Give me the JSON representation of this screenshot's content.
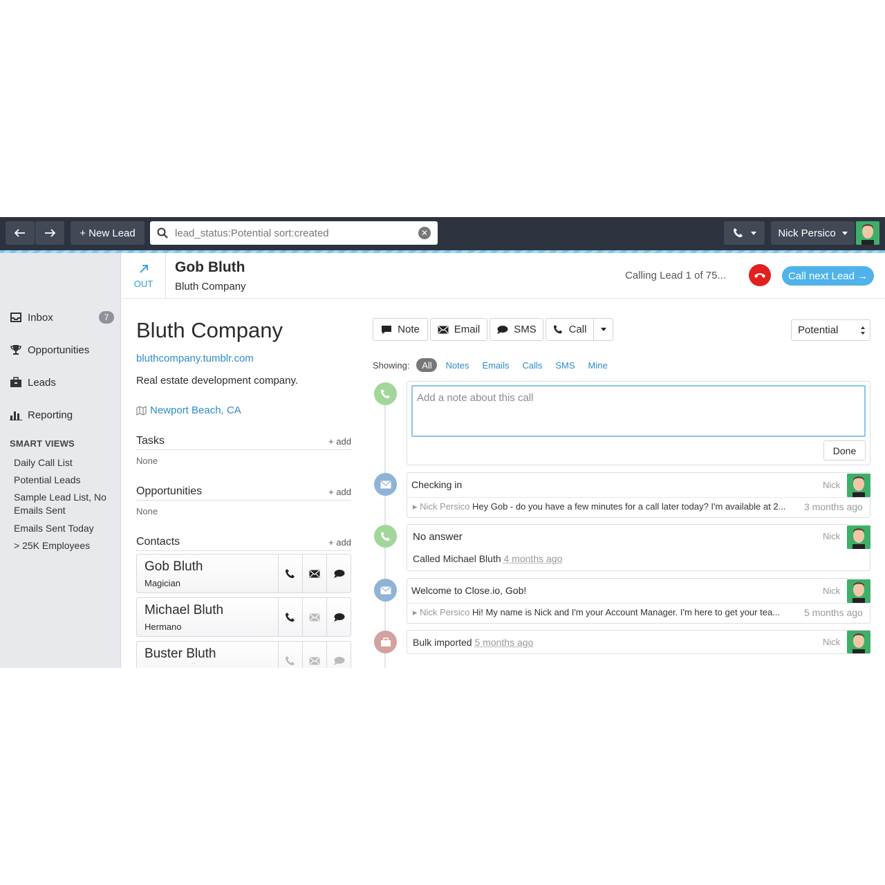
{
  "topbar": {
    "new_lead_label": "+ New Lead",
    "search_value": "lead_status:Potential sort:created",
    "user_name": "Nick Persico"
  },
  "sidebar": {
    "items": [
      {
        "label": "Inbox",
        "icon": "inbox-icon",
        "badge": "7"
      },
      {
        "label": "Opportunities",
        "icon": "trophy-icon"
      },
      {
        "label": "Leads",
        "icon": "briefcase-icon"
      },
      {
        "label": "Reporting",
        "icon": "bar-chart-icon"
      }
    ],
    "smart_views_heading": "SMART VIEWS",
    "smart_views": [
      "Daily Call List",
      "Potential Leads",
      "Sample Lead List, No Emails Sent",
      "Emails Sent Today",
      "> 25K Employees"
    ]
  },
  "lead_header": {
    "direction": "OUT",
    "name": "Gob Bluth",
    "company": "Bluth Company",
    "calling_status": "Calling Lead 1 of 75...",
    "call_next_label": "Call next Lead →"
  },
  "company": {
    "title": "Bluth Company",
    "url": "bluthcompany.tumblr.com",
    "description": "Real estate development company.",
    "location": "Newport Beach, CA"
  },
  "sections": {
    "tasks": {
      "title": "Tasks",
      "add": "+ add",
      "empty": "None"
    },
    "opportunities": {
      "title": "Opportunities",
      "add": "+ add",
      "empty": "None"
    },
    "contacts": {
      "title": "Contacts",
      "add": "+ add"
    }
  },
  "contacts": [
    {
      "name": "Gob Bluth",
      "role": "Magician"
    },
    {
      "name": "Michael Bluth",
      "role": "Hermano"
    },
    {
      "name": "Buster Bluth",
      "role": ""
    }
  ],
  "actions": {
    "note": "Note",
    "email": "Email",
    "sms": "SMS",
    "call": "Call",
    "status": "Potential"
  },
  "filters": {
    "label": "Showing:",
    "items": [
      "All",
      "Notes",
      "Emails",
      "Calls",
      "SMS",
      "Mine"
    ]
  },
  "note_form": {
    "placeholder": "Add a note about this call",
    "done": "Done"
  },
  "activities": [
    {
      "title": "Checking in",
      "user": "Nick",
      "sender": "Nick Persico",
      "preview": "Hey Gob - do you have a few minutes for a call later today? I'm available at 2...",
      "time": "3 months ago"
    },
    {
      "title": "No answer",
      "user": "Nick",
      "detail": "Called Michael Bluth",
      "time": "4 months ago"
    },
    {
      "title": "Welcome to Close.io, Gob!",
      "user": "Nick",
      "sender": "Nick Persico",
      "preview": "Hi! My name is Nick and I'm your Account Manager. I'm here to get your tea...",
      "time": "5 months ago"
    },
    {
      "title": "Bulk imported",
      "user": "Nick",
      "time": "5 months ago"
    }
  ],
  "colors": {
    "topbar": "#2c333e",
    "accent_blue": "#2d8bc9",
    "call_green": "#a3d69b",
    "email_blue": "#8fb3d6",
    "import_red": "#d4a0a0",
    "hangup_red": "#e0211f"
  }
}
